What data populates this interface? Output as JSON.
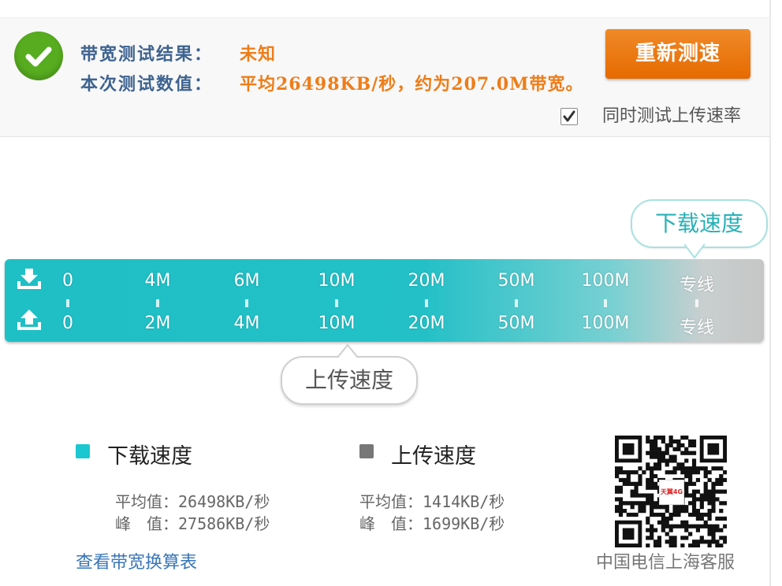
{
  "result": {
    "label1": "带宽测试结果：",
    "value1": "未知",
    "label2": "本次测试数值：",
    "value2": "平均26498KB/秒，约为207.0M带宽。"
  },
  "retest_label": "重新测速",
  "upload_checkbox": {
    "label": "同时测试上传速率",
    "checked": true
  },
  "scale": {
    "download_ticks": [
      "0",
      "4M",
      "6M",
      "10M",
      "20M",
      "50M",
      "100M",
      "专线"
    ],
    "upload_ticks": [
      "0",
      "2M",
      "4M",
      "10M",
      "20M",
      "50M",
      "100M",
      "专线"
    ],
    "download_bubble": "下载速度",
    "upload_bubble": "上传速度"
  },
  "legend": {
    "download": {
      "title": "下载速度",
      "color": "#1bc7d1",
      "avg": "平均值：26498KB/秒",
      "peak": "峰　值：27586KB/秒"
    },
    "upload": {
      "title": "上传速度",
      "color": "#777777",
      "avg": "平均值：1414KB/秒",
      "peak": "峰　值：1699KB/秒"
    }
  },
  "conversion_link": "查看带宽换算表",
  "qr": {
    "caption": "中国电信上海客服",
    "badge": "天翼4G"
  },
  "colors": {
    "accent_orange": "#ee7d18",
    "label_blue": "#3e6390",
    "teal": "#1fbfc6",
    "success_green": "#57ad1f"
  }
}
